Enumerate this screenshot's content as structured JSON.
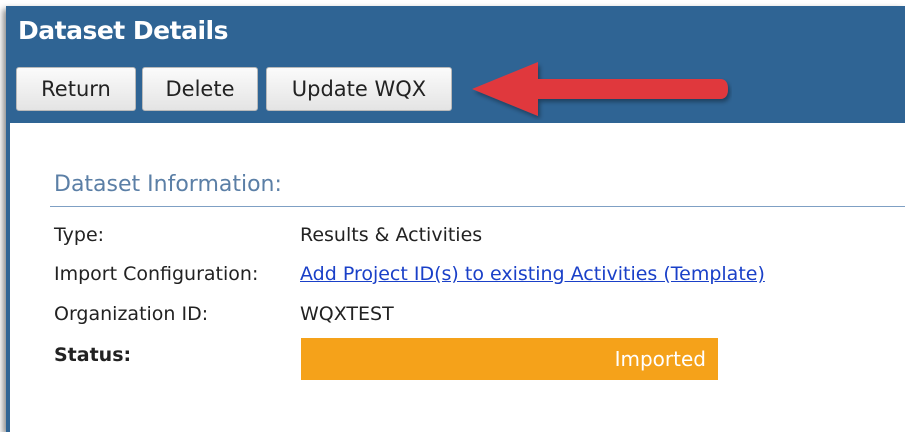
{
  "header": {
    "title": "Dataset Details",
    "buttons": {
      "return_label": "Return",
      "delete_label": "Delete",
      "update_label": "Update WQX"
    }
  },
  "section": {
    "title": "Dataset Information:"
  },
  "fields": {
    "type": {
      "label": "Type:",
      "value": "Results & Activities"
    },
    "import_config": {
      "label": "Import Configuration:",
      "value": "Add Project ID(s) to existing Activities (Template)"
    },
    "org_id": {
      "label": "Organization ID:",
      "value": "WQXTEST"
    },
    "status": {
      "label": "Status:",
      "value": "Imported"
    }
  },
  "colors": {
    "header_bg": "#2f6494",
    "status_bg": "#f5a21a",
    "arrow": "#e0393e",
    "link": "#1a40c8"
  }
}
